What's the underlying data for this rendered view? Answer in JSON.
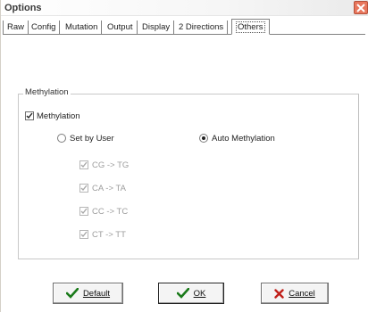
{
  "window": {
    "title": "Options"
  },
  "tabs": [
    {
      "label": "Raw"
    },
    {
      "label": "Config"
    },
    {
      "label": "Mutation"
    },
    {
      "label": "Output"
    },
    {
      "label": "Display"
    },
    {
      "label": "2 Directions"
    },
    {
      "label": "Others",
      "selected": true
    }
  ],
  "methylation_group": {
    "legend": "Methylation",
    "methylation_checkbox": {
      "label": "Methylation",
      "checked": true
    },
    "set_by_user_radio": {
      "label": "Set by User",
      "selected": false
    },
    "auto_methylation_radio": {
      "label": "Auto Methylation",
      "selected": true
    },
    "conversions": [
      {
        "label": "CG -> TG",
        "checked": true,
        "enabled": false
      },
      {
        "label": "CA -> TA",
        "checked": true,
        "enabled": false
      },
      {
        "label": "CC -> TC",
        "checked": true,
        "enabled": false
      },
      {
        "label": "CT -> TT",
        "checked": true,
        "enabled": false
      }
    ]
  },
  "buttons": {
    "default_label": "Default",
    "ok_label": "OK",
    "cancel_label": "Cancel"
  },
  "colors": {
    "check": "#1a7a1a",
    "cancel_x": "#c0201a",
    "close_bg": "#e8765c"
  }
}
